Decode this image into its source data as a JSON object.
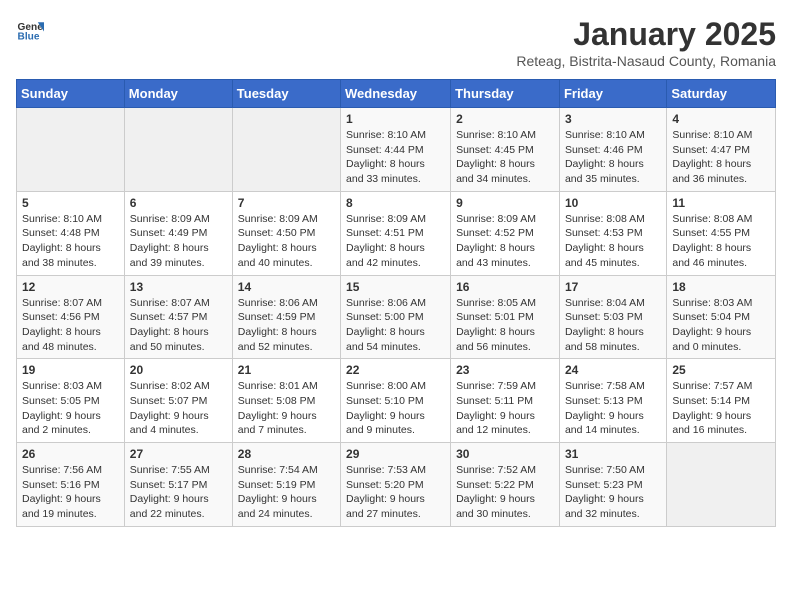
{
  "header": {
    "logo_general": "General",
    "logo_blue": "Blue",
    "title": "January 2025",
    "subtitle": "Reteag, Bistrita-Nasaud County, Romania"
  },
  "weekdays": [
    "Sunday",
    "Monday",
    "Tuesday",
    "Wednesday",
    "Thursday",
    "Friday",
    "Saturday"
  ],
  "weeks": [
    [
      {
        "day": "",
        "info": ""
      },
      {
        "day": "",
        "info": ""
      },
      {
        "day": "",
        "info": ""
      },
      {
        "day": "1",
        "info": "Sunrise: 8:10 AM\nSunset: 4:44 PM\nDaylight: 8 hours\nand 33 minutes."
      },
      {
        "day": "2",
        "info": "Sunrise: 8:10 AM\nSunset: 4:45 PM\nDaylight: 8 hours\nand 34 minutes."
      },
      {
        "day": "3",
        "info": "Sunrise: 8:10 AM\nSunset: 4:46 PM\nDaylight: 8 hours\nand 35 minutes."
      },
      {
        "day": "4",
        "info": "Sunrise: 8:10 AM\nSunset: 4:47 PM\nDaylight: 8 hours\nand 36 minutes."
      }
    ],
    [
      {
        "day": "5",
        "info": "Sunrise: 8:10 AM\nSunset: 4:48 PM\nDaylight: 8 hours\nand 38 minutes."
      },
      {
        "day": "6",
        "info": "Sunrise: 8:09 AM\nSunset: 4:49 PM\nDaylight: 8 hours\nand 39 minutes."
      },
      {
        "day": "7",
        "info": "Sunrise: 8:09 AM\nSunset: 4:50 PM\nDaylight: 8 hours\nand 40 minutes."
      },
      {
        "day": "8",
        "info": "Sunrise: 8:09 AM\nSunset: 4:51 PM\nDaylight: 8 hours\nand 42 minutes."
      },
      {
        "day": "9",
        "info": "Sunrise: 8:09 AM\nSunset: 4:52 PM\nDaylight: 8 hours\nand 43 minutes."
      },
      {
        "day": "10",
        "info": "Sunrise: 8:08 AM\nSunset: 4:53 PM\nDaylight: 8 hours\nand 45 minutes."
      },
      {
        "day": "11",
        "info": "Sunrise: 8:08 AM\nSunset: 4:55 PM\nDaylight: 8 hours\nand 46 minutes."
      }
    ],
    [
      {
        "day": "12",
        "info": "Sunrise: 8:07 AM\nSunset: 4:56 PM\nDaylight: 8 hours\nand 48 minutes."
      },
      {
        "day": "13",
        "info": "Sunrise: 8:07 AM\nSunset: 4:57 PM\nDaylight: 8 hours\nand 50 minutes."
      },
      {
        "day": "14",
        "info": "Sunrise: 8:06 AM\nSunset: 4:59 PM\nDaylight: 8 hours\nand 52 minutes."
      },
      {
        "day": "15",
        "info": "Sunrise: 8:06 AM\nSunset: 5:00 PM\nDaylight: 8 hours\nand 54 minutes."
      },
      {
        "day": "16",
        "info": "Sunrise: 8:05 AM\nSunset: 5:01 PM\nDaylight: 8 hours\nand 56 minutes."
      },
      {
        "day": "17",
        "info": "Sunrise: 8:04 AM\nSunset: 5:03 PM\nDaylight: 8 hours\nand 58 minutes."
      },
      {
        "day": "18",
        "info": "Sunrise: 8:03 AM\nSunset: 5:04 PM\nDaylight: 9 hours\nand 0 minutes."
      }
    ],
    [
      {
        "day": "19",
        "info": "Sunrise: 8:03 AM\nSunset: 5:05 PM\nDaylight: 9 hours\nand 2 minutes."
      },
      {
        "day": "20",
        "info": "Sunrise: 8:02 AM\nSunset: 5:07 PM\nDaylight: 9 hours\nand 4 minutes."
      },
      {
        "day": "21",
        "info": "Sunrise: 8:01 AM\nSunset: 5:08 PM\nDaylight: 9 hours\nand 7 minutes."
      },
      {
        "day": "22",
        "info": "Sunrise: 8:00 AM\nSunset: 5:10 PM\nDaylight: 9 hours\nand 9 minutes."
      },
      {
        "day": "23",
        "info": "Sunrise: 7:59 AM\nSunset: 5:11 PM\nDaylight: 9 hours\nand 12 minutes."
      },
      {
        "day": "24",
        "info": "Sunrise: 7:58 AM\nSunset: 5:13 PM\nDaylight: 9 hours\nand 14 minutes."
      },
      {
        "day": "25",
        "info": "Sunrise: 7:57 AM\nSunset: 5:14 PM\nDaylight: 9 hours\nand 16 minutes."
      }
    ],
    [
      {
        "day": "26",
        "info": "Sunrise: 7:56 AM\nSunset: 5:16 PM\nDaylight: 9 hours\nand 19 minutes."
      },
      {
        "day": "27",
        "info": "Sunrise: 7:55 AM\nSunset: 5:17 PM\nDaylight: 9 hours\nand 22 minutes."
      },
      {
        "day": "28",
        "info": "Sunrise: 7:54 AM\nSunset: 5:19 PM\nDaylight: 9 hours\nand 24 minutes."
      },
      {
        "day": "29",
        "info": "Sunrise: 7:53 AM\nSunset: 5:20 PM\nDaylight: 9 hours\nand 27 minutes."
      },
      {
        "day": "30",
        "info": "Sunrise: 7:52 AM\nSunset: 5:22 PM\nDaylight: 9 hours\nand 30 minutes."
      },
      {
        "day": "31",
        "info": "Sunrise: 7:50 AM\nSunset: 5:23 PM\nDaylight: 9 hours\nand 32 minutes."
      },
      {
        "day": "",
        "info": ""
      }
    ]
  ]
}
